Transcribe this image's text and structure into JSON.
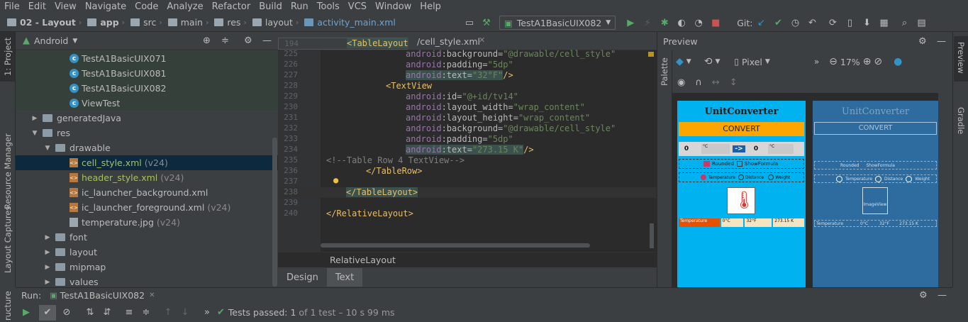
{
  "menu": [
    "File",
    "Edit",
    "View",
    "Navigate",
    "Code",
    "Analyze",
    "Refactor",
    "Build",
    "Run",
    "Tools",
    "VCS",
    "Window",
    "Help"
  ],
  "breadcrumbs": [
    "02 - Layout",
    "app",
    "src",
    "main",
    "res",
    "layout",
    "activity_main.xml"
  ],
  "toolbar": {
    "run_config": "TestA1BasicUIX082",
    "git_label": "Git:"
  },
  "left_stripe": {
    "project_tab": "1: Project",
    "resource_manager": "Resource Manager",
    "layout_captures": "Layout Captures",
    "structure": "ructure"
  },
  "right_stripe": {
    "preview_tab": "Preview",
    "gradle_tab": "Gradle"
  },
  "project_panel": {
    "view_mode": "Android",
    "items": [
      {
        "label": "TestA1BasicUIX071",
        "suffix": "",
        "type": "class"
      },
      {
        "label": "TestA1BasicUIX081",
        "suffix": "",
        "type": "class"
      },
      {
        "label": "TestA1BasicUIX082",
        "suffix": "",
        "type": "class"
      },
      {
        "label": "ViewTest",
        "suffix": "",
        "type": "class"
      },
      {
        "label": "generatedJava",
        "suffix": "",
        "type": "folder"
      },
      {
        "label": "res",
        "suffix": "",
        "type": "folder"
      },
      {
        "label": "drawable",
        "suffix": "",
        "type": "folder"
      },
      {
        "label": "cell_style.xml",
        "suffix": "(v24)",
        "type": "xml"
      },
      {
        "label": "header_style.xml",
        "suffix": "(v24)",
        "type": "xml"
      },
      {
        "label": "ic_launcher_background.xml",
        "suffix": "",
        "type": "xml"
      },
      {
        "label": "ic_launcher_foreground.xml",
        "suffix": "(v24)",
        "type": "xml"
      },
      {
        "label": "temperature.jpg",
        "suffix": "(v24)",
        "type": "image"
      },
      {
        "label": "font",
        "suffix": "",
        "type": "folder"
      },
      {
        "label": "layout",
        "suffix": "",
        "type": "folder"
      },
      {
        "label": "mipmap",
        "suffix": "",
        "type": "folder"
      },
      {
        "label": "values",
        "suffix": "",
        "type": "folder"
      }
    ]
  },
  "editor": {
    "tab_popup": "<TableLayout",
    "tab_name": "/cell_style.xml",
    "lines": [
      {
        "num": "194",
        "text": ""
      },
      {
        "num": "225",
        "text": "android:background=\"@drawable/cell_style\""
      },
      {
        "num": "226",
        "text": "android:padding=\"5dp\""
      },
      {
        "num": "227",
        "text": "android:text=\"32°F\"/>"
      },
      {
        "num": "228",
        "text": "<TextView"
      },
      {
        "num": "229",
        "text": "android:id=\"@+id/tv14\""
      },
      {
        "num": "230",
        "text": "android:layout_width=\"wrap_content\""
      },
      {
        "num": "231",
        "text": "android:layout_height=\"wrap_content\""
      },
      {
        "num": "232",
        "text": "android:background=\"@drawable/cell_style\""
      },
      {
        "num": "233",
        "text": "android:padding=\"5dp\""
      },
      {
        "num": "234",
        "text": "android:text=\"273.15 K\"/>"
      },
      {
        "num": "235",
        "text": "<!--Table Row 4 TextView-->"
      },
      {
        "num": "236",
        "text": "</TableRow>"
      },
      {
        "num": "237",
        "text": ""
      },
      {
        "num": "238",
        "text": "</TableLayout>"
      },
      {
        "num": "239",
        "text": ""
      },
      {
        "num": "240",
        "text": "</RelativeLayout>"
      }
    ],
    "breadcrumb": "RelativeLayout",
    "tabs": [
      "Design",
      "Text"
    ]
  },
  "preview": {
    "title": "Preview",
    "device": "Pixel",
    "zoom": "17%",
    "palette_label": "Palette",
    "app_title": "UnitConverter",
    "convert_btn": "CONVERT",
    "zero": "0",
    "unit_c": "°C",
    "arrow": "->",
    "rounded": "Rounded",
    "show_formula": "ShowFormula",
    "temperature": "Temperature",
    "distance": "Distance",
    "weight": "Weight",
    "row_temp": "Temperature",
    "row_c": "0°C",
    "row_f": "32°F",
    "row_k": "273.15 K",
    "image_view": "ImageView"
  },
  "run_panel": {
    "label": "Run:",
    "config": "TestA1BasicUIX082",
    "status_prefix": "Tests passed:",
    "status_count": "1",
    "status_suffix": "of 1 test – 10 s 99 ms"
  },
  "colors": {
    "accent_green": "#59a869",
    "phone_bg": "#00b2f0",
    "button_orange": "#ffa500",
    "blueprint": "#2e6b9e"
  }
}
